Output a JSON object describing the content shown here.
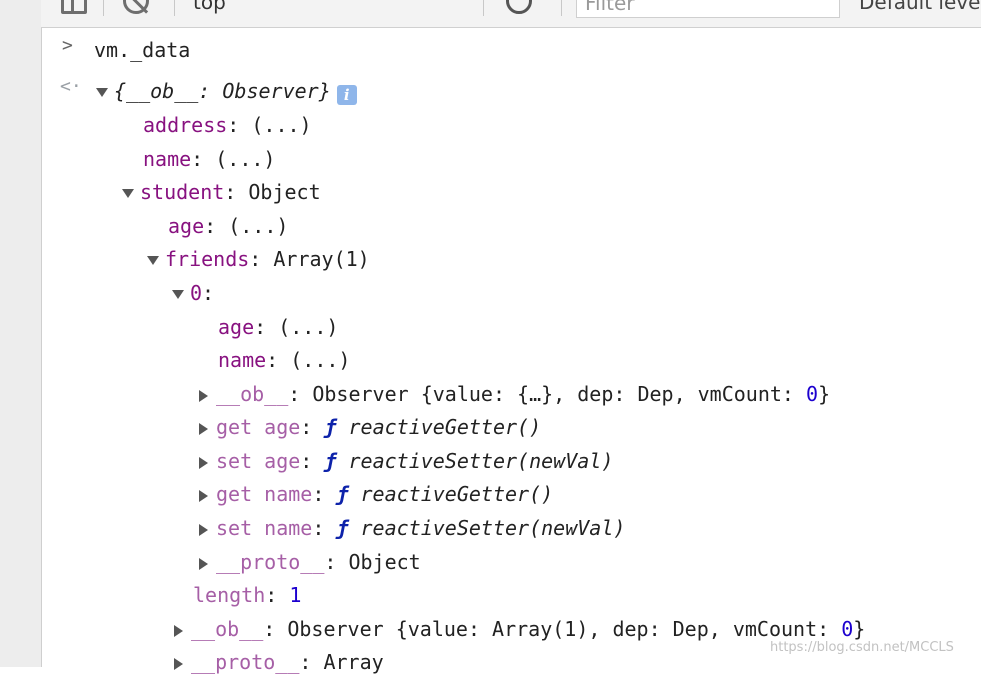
{
  "toolbar": {
    "context": "top",
    "filter_placeholder": "Filter",
    "levels_label": "Default levels"
  },
  "console": {
    "input": "vm._data",
    "result_header": "{__ob__: Observer}",
    "info_badge": "i",
    "rows": {
      "address_key": "address",
      "address_val": ": (...)",
      "name_key": "name",
      "name_val": ": (...)",
      "student_key": "student",
      "student_val": ": Object",
      "age_key": "age",
      "age_val": ": (...)",
      "friends_key": "friends",
      "friends_val": ": Array(1)",
      "zero_key": "0",
      "zero_val": ":",
      "f_age_key": "age",
      "f_age_val": ": (...)",
      "f_name_key": "name",
      "f_name_val": ": (...)",
      "ob_key": "__ob__",
      "ob_val_pre": ": Observer {value: {…}, dep: Dep, vmCount: ",
      "ob_val_num": "0",
      "ob_val_post": "}",
      "get_age_key": "get age",
      "get_age_fn": "reactiveGetter()",
      "set_age_key": "set age",
      "set_age_fn": "reactiveSetter(newVal)",
      "get_name_key": "get name",
      "get_name_fn": "reactiveGetter()",
      "set_name_key": "set name",
      "set_name_fn": "reactiveSetter(newVal)",
      "proto_key": "__proto__",
      "proto_val": ": Object",
      "length_key": "length",
      "length_colon": ": ",
      "length_num": "1",
      "arr_ob_key": "__ob__",
      "arr_ob_pre": ": Observer {value: Array(1), dep: Dep, vmCount: ",
      "arr_ob_num": "0",
      "arr_ob_post": "}",
      "arr_proto_key": "__proto__",
      "arr_proto_val": ": Array"
    },
    "fn_symbol": "ƒ"
  },
  "watermark": "https://blog.csdn.net/MCCLS",
  "colors": {
    "key": "#881280",
    "number": "#1c00cf",
    "function": "#0d22aa"
  },
  "icons": [
    "panel-toggle-icon",
    "clear-console-icon",
    "eye-icon",
    "info-icon",
    "expand-arrow-icon",
    "collapse-arrow-icon",
    "mouse-cursor-icon"
  ]
}
